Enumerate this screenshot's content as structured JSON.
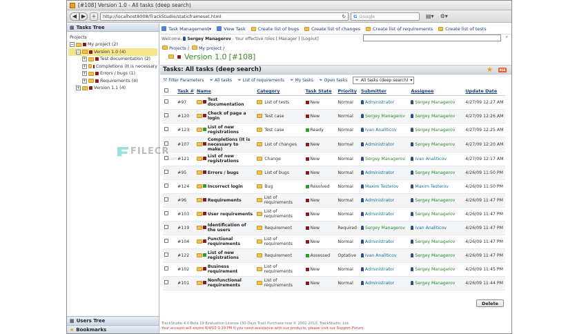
{
  "window": {
    "title": "[#108] Version 1.0 - All tasks (deep search)"
  },
  "browser": {
    "url": "http://localhost8008/TrackStudio/staticframeset.html",
    "search_placeholder": "Google",
    "back": "◀",
    "fwd": "▶",
    "plus": "+"
  },
  "left": {
    "header": "Tasks Tree",
    "root": "Projects",
    "items": [
      {
        "label": "My project (2)",
        "level": 0,
        "exp": "−"
      },
      {
        "label": "Version 1.0 (4)",
        "level": 1,
        "exp": "−",
        "selected": true
      },
      {
        "label": "Test documentation (2)",
        "level": 2,
        "exp": "+"
      },
      {
        "label": "Completions (It is necessary",
        "level": 2,
        "exp": "+"
      },
      {
        "label": "Errors / bugs (1)",
        "level": 2,
        "exp": "+"
      },
      {
        "label": "Requirements (4)",
        "level": 2,
        "exp": "+"
      },
      {
        "label": "Version 1.1 (4)",
        "level": 1,
        "exp": "+"
      }
    ],
    "users_tree": "Users Tree",
    "bookmarks": "Bookmarks"
  },
  "toolbar": {
    "task_management": "Task Management▾",
    "view_task": "View Task",
    "create_bugs": "Create list of bugs",
    "create_changes": "Create list of changes",
    "create_requirements": "Create list of requirements",
    "create_tests": "Create list of tests"
  },
  "welcome": {
    "prefix": "Welcome,",
    "user": "Sergey Managerov",
    "roles": ". Your effective roles [ Manager ]",
    "logout": "[Logout]"
  },
  "breadcrumb": {
    "projects": "Projects /",
    "my_project": "My project /"
  },
  "version_title": "Version 1.0",
  "version_id": "[#108]",
  "panel_title": "Tasks: All tasks (deep search)",
  "rss": "RSS",
  "filters": {
    "params": "Filter Parameters",
    "all": "All tasks",
    "reqs": "List of requirements",
    "my": "My tasks",
    "open": "Open tasks",
    "selected": "All tasks (deep search)"
  },
  "table": {
    "headers": [
      "Task #",
      "Name",
      "Category",
      "Task State",
      "Priority",
      "Submitter",
      "Assignee",
      "Update Date"
    ],
    "rows": [
      {
        "id": "#97",
        "name": "Test documentation",
        "cat": "List of tests",
        "state": "New",
        "st": "#8b1a1a",
        "prio": "Normal",
        "sub": "Administrator",
        "subg": false,
        "asg": "Sergey Managerov",
        "asgg": true,
        "date": "4/27/09 12:27 AM",
        "tc": "#8b1a1a"
      },
      {
        "id": "#120",
        "name": "Check of page a login",
        "cat": "Test case",
        "state": "New",
        "st": "#8b1a1a",
        "prio": "Normal",
        "sub": "Sergey Managerov",
        "subg": true,
        "asg": "Sergey Managerov",
        "asgg": true,
        "date": "4/27/09 12:26 AM",
        "tc": "#8b1a1a"
      },
      {
        "id": "#123",
        "name": "List of new registrations",
        "cat": "Test case",
        "state": "Ready",
        "st": "#2aa02a",
        "prio": "Normal",
        "sub": "Ivan Analiticov",
        "subg": false,
        "asg": "Sergey Managerov",
        "asgg": true,
        "date": "4/27/09 12:25 AM",
        "tc": "#2aa02a"
      },
      {
        "id": "#107",
        "name": "Completions (It is necessary to make)",
        "cat": "List of changes",
        "state": "New",
        "st": "#8b1a1a",
        "prio": "Normal",
        "sub": "Administrator",
        "subg": false,
        "asg": "Sergey Managerov",
        "asgg": true,
        "date": "4/27/09 12:20 AM",
        "tc": "#8b1a1a"
      },
      {
        "id": "#121",
        "name": "List of new registrations",
        "cat": "Change",
        "state": "New",
        "st": "#8b1a1a",
        "prio": "Normal",
        "sub": "Sergey Managerov",
        "subg": true,
        "asg": "Ivan Analiticov",
        "asgg": false,
        "date": "4/27/09 12:17 AM",
        "tc": "#8b1a1a"
      },
      {
        "id": "#95",
        "name": "Errors / bugs",
        "cat": "List of bugs",
        "state": "New",
        "st": "#8b1a1a",
        "prio": "Normal",
        "sub": "Administrator",
        "subg": false,
        "asg": "Sergey Managerov",
        "asgg": true,
        "date": "4/26/09 11:50 PM",
        "tc": "#8b1a1a"
      },
      {
        "id": "#124",
        "name": "Incorrect login",
        "cat": "Bug",
        "state": "Resolved",
        "st": "#2aa02a",
        "prio": "Normal",
        "sub": "Maxim Testerov",
        "subg": false,
        "asg": "Maxim Testerov",
        "asgg": false,
        "date": "4/26/09 11:50 PM",
        "tc": "#2aa02a"
      },
      {
        "id": "#96",
        "name": "Requirements",
        "cat": "List of requirements",
        "state": "New",
        "st": "#8b1a1a",
        "prio": "Normal",
        "sub": "Administrator",
        "subg": false,
        "asg": "Sergey Managerov",
        "asgg": true,
        "date": "4/26/09 11:47 PM",
        "tc": "#8b1a1a"
      },
      {
        "id": "#103",
        "name": "User requirements",
        "cat": "List of requirements",
        "state": "New",
        "st": "#8b1a1a",
        "prio": "Normal",
        "sub": "Administrator",
        "subg": false,
        "asg": "Sergey Managerov",
        "asgg": true,
        "date": "4/26/09 11:47 PM",
        "tc": "#8b1a1a"
      },
      {
        "id": "#119",
        "name": "Identification of the users",
        "cat": "Requirement",
        "state": "New",
        "st": "#8b1a1a",
        "prio": "Required",
        "sub": "Sergey Managerov",
        "subg": true,
        "asg": "Ivan Analiticov",
        "asgg": false,
        "date": "4/26/09 11:47 PM",
        "tc": "#8b1a1a"
      },
      {
        "id": "#104",
        "name": "Functional requirements",
        "cat": "List of requirements",
        "state": "New",
        "st": "#8b1a1a",
        "prio": "Normal",
        "sub": "Administrator",
        "subg": false,
        "asg": "Sergey Managerov",
        "asgg": true,
        "date": "4/26/09 11:47 PM",
        "tc": "#8b1a1a"
      },
      {
        "id": "#122",
        "name": "List of new registrations",
        "cat": "Requirement",
        "state": "Assessed",
        "st": "#2aa02a",
        "prio": "Optative",
        "sub": "Ivan Analiticov",
        "subg": false,
        "asg": "Sergey Managerov",
        "asgg": true,
        "date": "4/26/09 11:47 PM",
        "tc": "#2aa02a"
      },
      {
        "id": "#102",
        "name": "Business requirement",
        "cat": "List of requirements",
        "state": "New",
        "st": "#8b1a1a",
        "prio": "Normal",
        "sub": "Administrator",
        "subg": false,
        "asg": "Sergey Managerov",
        "asgg": true,
        "date": "4/26/09 11:45 PM",
        "tc": "#8b1a1a"
      },
      {
        "id": "#101",
        "name": "Nonfunctional requirements",
        "cat": "List of requirements",
        "state": "New",
        "st": "#8b1a1a",
        "prio": "Normal",
        "sub": "Administrator",
        "subg": false,
        "asg": "Sergey Managerov",
        "asgg": true,
        "date": "4/26/09 11:44 PM",
        "tc": "#8b1a1a"
      }
    ]
  },
  "delete_label": "Delete",
  "footer": {
    "line1": "TrackStudio 4.0 Beta 19 Evaluation License (30-Days Trial)  Purchase now  © 2002-2010. TrackStudio, Ltd.",
    "line2": "Your account will expire 6/4/10 3:19 PM  If you need assistance with our products, please visit our Support Forum."
  },
  "watermark": {
    "text": "FILECR",
    "sub": ".com"
  }
}
